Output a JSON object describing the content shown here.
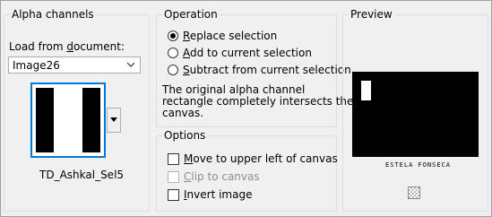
{
  "alpha_channels": {
    "title": "Alpha channels",
    "load_label_pre": "Load from ",
    "load_label_u": "d",
    "load_label_post": "ocument:",
    "document_value": "Image26",
    "selection_name": "TD_Ashkal_Sel5"
  },
  "operation": {
    "title": "Operation",
    "options": [
      {
        "u": "R",
        "rest": "eplace selection",
        "checked": true
      },
      {
        "u": "A",
        "rest": "dd to current selection",
        "checked": false
      },
      {
        "u": "S",
        "rest": "ubtract from current selection",
        "checked": false
      }
    ],
    "description_line1": "The original alpha channel",
    "description_line2": "rectangle completely intersects the",
    "description_line3": "canvas."
  },
  "options": {
    "title": "Options",
    "move": {
      "u": "M",
      "rest": "ove to upper left of canvas",
      "checked": false,
      "enabled": true
    },
    "clip": {
      "u": "C",
      "rest": "lip to canvas",
      "checked": false,
      "enabled": false
    },
    "invert": {
      "u": "I",
      "rest": "nvert image",
      "checked": false,
      "enabled": true
    }
  },
  "preview": {
    "title": "Preview",
    "watermark": "ESTELA FONSECA"
  }
}
